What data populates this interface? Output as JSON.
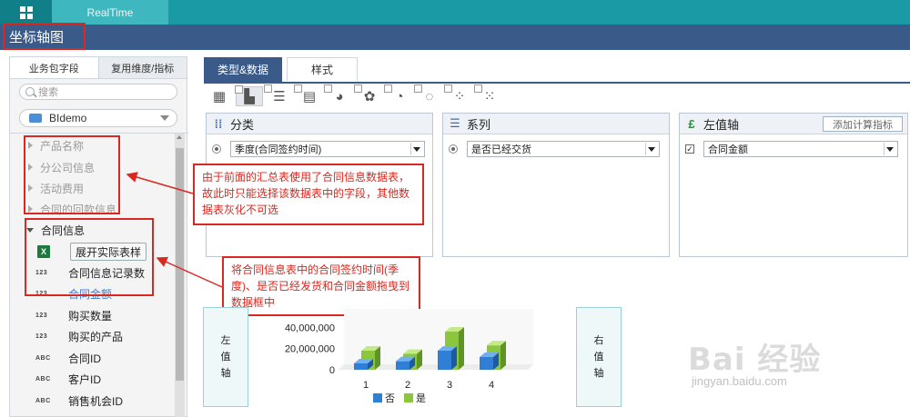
{
  "topbar": {
    "active_tab": "RealTime"
  },
  "title": "坐标轴图",
  "left_panel": {
    "tabs": [
      "业务包字段",
      "复用维度/指标"
    ],
    "search_placeholder": "搜索",
    "package": "BIdemo",
    "greyed_tables": [
      "产品名称",
      "分公司信息",
      "活动费用",
      "合同的回款信息"
    ],
    "active_table": "合同信息",
    "expand_button": "展开实际表样",
    "fields": [
      {
        "type": "123",
        "name": "合同信息记录数"
      },
      {
        "type": "123",
        "name": "合同金额",
        "highlight": true
      },
      {
        "type": "123",
        "name": "购买数量"
      },
      {
        "type": "123",
        "name": "购买的产品"
      },
      {
        "type": "ABC",
        "name": "合同ID"
      },
      {
        "type": "ABC",
        "name": "客户ID"
      },
      {
        "type": "ABC",
        "name": "销售机会ID"
      }
    ]
  },
  "main_tabs": [
    "类型&数据",
    "样式"
  ],
  "chart_type_icons": [
    "table-icon",
    "bar-chart-icon",
    "horizontal-bar-icon",
    "stacked-bar-icon",
    "pie-chart-icon",
    "map-icon",
    "gauge-icon",
    "donut-icon",
    "bubble-icon",
    "scatter-icon"
  ],
  "boxes": {
    "category": {
      "title": "分类",
      "value": "季度(合同签约时间)"
    },
    "series": {
      "title": "系列",
      "value": "是否已经交货"
    },
    "left_axis": {
      "title": "左值轴",
      "add_button": "添加计算指标",
      "value": "合同金额"
    }
  },
  "annotations": {
    "callout1": "由于前面的汇总表使用了合同信息数据表，故此时只能选择该数据表中的字段，其他数据表灰化不可选",
    "callout2": "将合同信息表中的合同签约时间(季度)、是否已经发货和合同金额拖曳到数据框中"
  },
  "axis_boxes": {
    "left": [
      "左",
      "值",
      "轴"
    ],
    "right": [
      "右",
      "值",
      "轴"
    ]
  },
  "colors": {
    "teal": "#1a9aa5",
    "navy": "#3a5a8a",
    "red": "#d9281f",
    "blue": "#2f7fd6",
    "green": "#8cc63f"
  },
  "chart_data": {
    "type": "bar",
    "categories": [
      "1",
      "2",
      "3",
      "4"
    ],
    "y_ticks": [
      "40,000,000",
      "20,000,000",
      "0"
    ],
    "ylim": [
      0,
      60000000
    ],
    "series": [
      {
        "name": "否",
        "values": [
          6000000,
          8000000,
          18000000,
          12000000
        ]
      },
      {
        "name": "是",
        "values": [
          18000000,
          15000000,
          36000000,
          23000000
        ]
      }
    ]
  },
  "watermark": {
    "logo": "Bai 经验",
    "url": "jingyan.baidu.com"
  }
}
